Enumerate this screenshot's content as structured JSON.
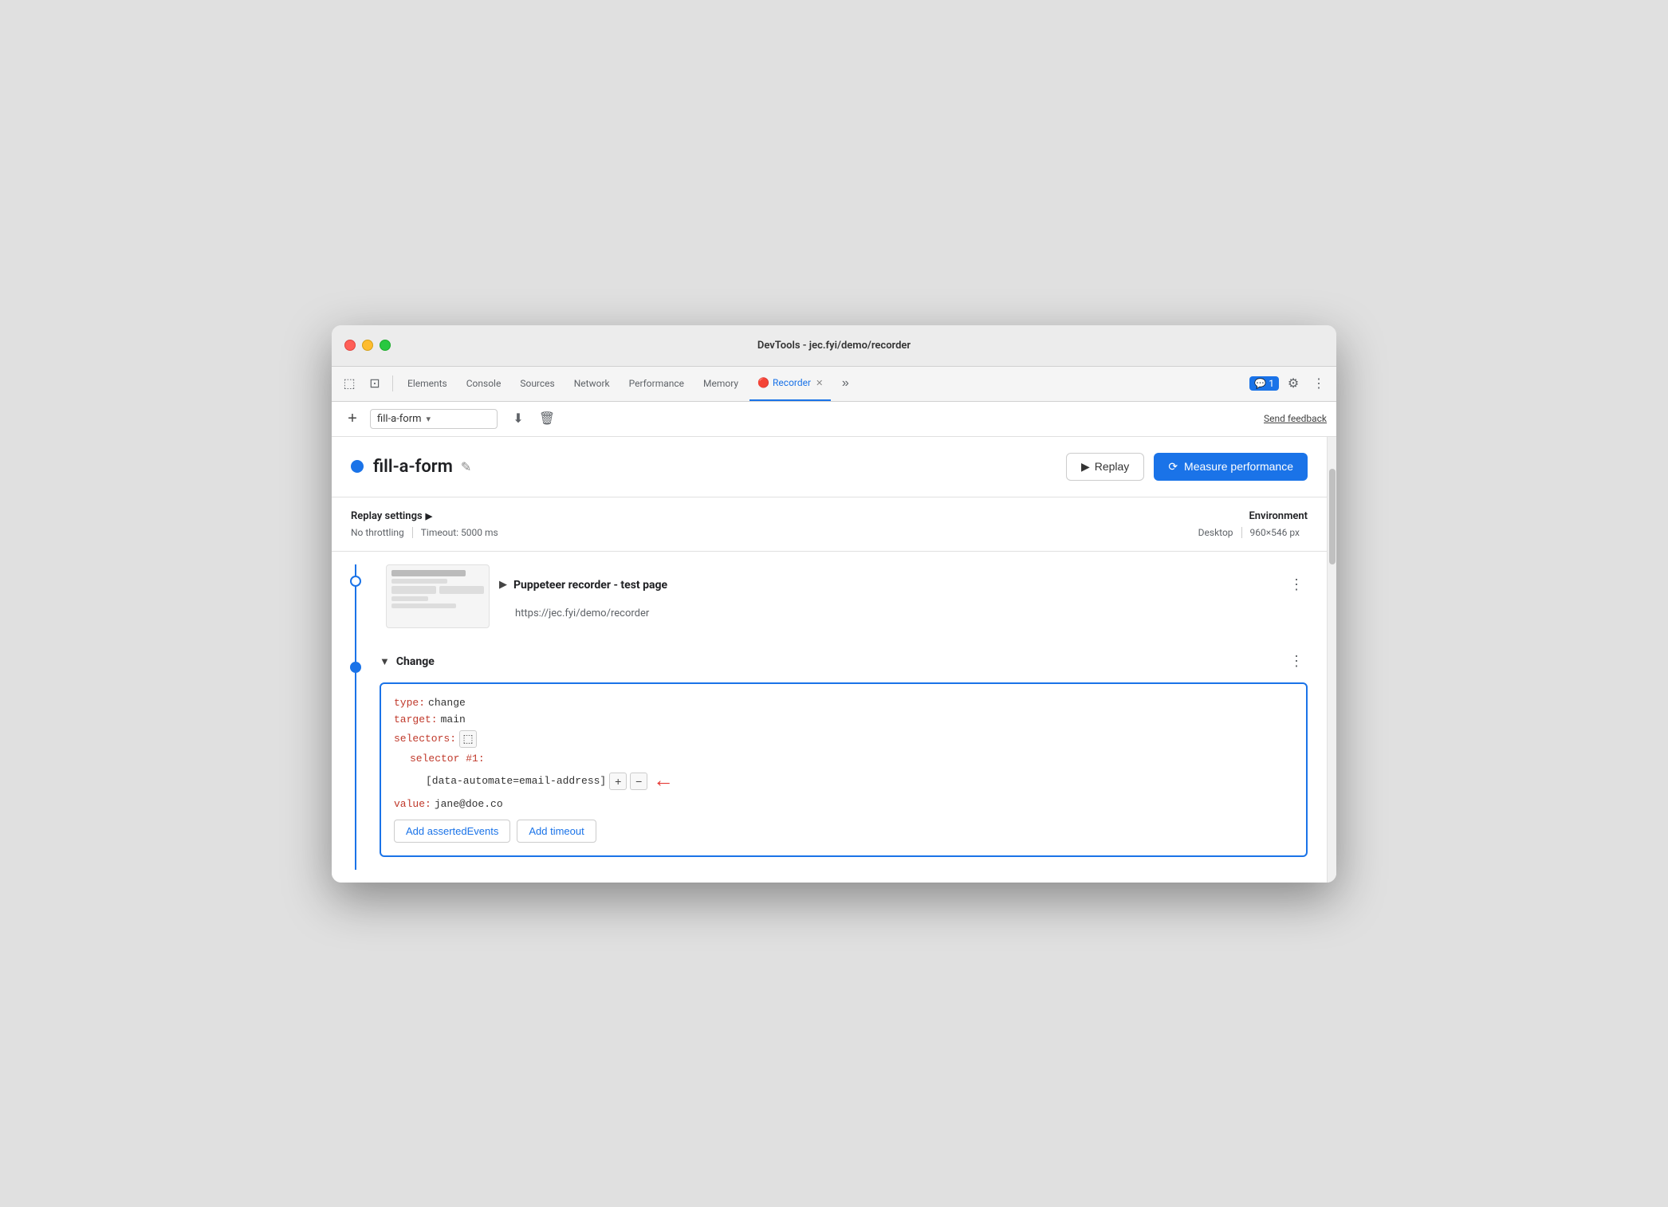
{
  "window": {
    "title": "DevTools - jec.fyi/demo/recorder"
  },
  "tabs": {
    "items": [
      {
        "label": "Elements",
        "active": false
      },
      {
        "label": "Console",
        "active": false
      },
      {
        "label": "Sources",
        "active": false
      },
      {
        "label": "Network",
        "active": false
      },
      {
        "label": "Performance",
        "active": false
      },
      {
        "label": "Memory",
        "active": false
      },
      {
        "label": "Recorder",
        "active": true
      },
      {
        "label": "more-tabs",
        "active": false
      }
    ],
    "chat_badge": "1",
    "recorder_tab": "Recorder"
  },
  "recorder_toolbar": {
    "add_label": "+",
    "recording_name": "fill-a-form",
    "send_feedback": "Send feedback"
  },
  "recording_header": {
    "name": "fill-a-form",
    "replay_label": "Replay",
    "measure_label": "Measure performance"
  },
  "settings": {
    "replay_settings_label": "Replay settings",
    "no_throttling": "No throttling",
    "timeout": "Timeout: 5000 ms",
    "environment_label": "Environment",
    "env_type": "Desktop",
    "env_size": "960×546 px"
  },
  "step1": {
    "title": "Puppeteer recorder - test page",
    "url": "https://jec.fyi/demo/recorder"
  },
  "step2": {
    "title": "Change",
    "code": {
      "type_key": "type:",
      "type_val": "change",
      "target_key": "target:",
      "target_val": "main",
      "selectors_key": "selectors:",
      "selector1_key": "selector #1:",
      "selector1_val": "[data-automate=email-address]",
      "value_key": "value:",
      "value_val": "jane@doe.co"
    },
    "add_asserted_events": "Add assertedEvents",
    "add_timeout": "Add timeout"
  },
  "icons": {
    "cursor": "⬚",
    "maximize": "⊡",
    "play": "▶",
    "measure_icon": "⟳",
    "edit": "✎",
    "more": "⋮",
    "chevron_down": "▾",
    "expand_right": "▶",
    "expand_down": "▼",
    "download": "⬇",
    "delete": "🗑",
    "plus": "+",
    "minus": "−",
    "arrow_right": "←",
    "gear": "⚙",
    "chat": "💬"
  }
}
